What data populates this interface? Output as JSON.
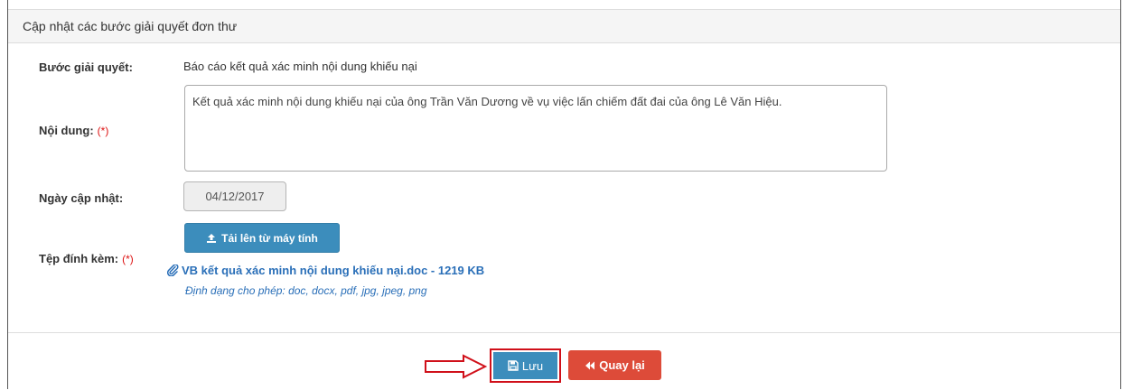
{
  "panel": {
    "title": "Cập nhật các bước giải quyết đơn thư"
  },
  "form": {
    "step_label": "Bước giải quyết:",
    "step_value": "Báo cáo kết quả xác minh nội dung khiếu nại",
    "content_label": "Nội dung:",
    "content_value": "Kết quả xác minh nội dung khiếu nại của ông Trần Văn Dương về vụ việc lấn chiếm đất đai của ông Lê Văn Hiệu.",
    "date_label": "Ngày cập nhật:",
    "date_value": "04/12/2017",
    "attach_label": "Tệp đính kèm:",
    "required_mark": "(*)",
    "upload_label": "Tải lên từ máy tính",
    "file_name": "VB kết quả xác minh nội dung khiếu nại.doc - 1219 KB",
    "formats_hint": "Định dạng cho phép: doc, docx, pdf, jpg, jpeg, png"
  },
  "actions": {
    "save_label": "Lưu",
    "back_label": "Quay lại"
  },
  "colors": {
    "primary": "#3c8dbc",
    "danger": "#dd4b39",
    "highlight": "#d0101a",
    "link": "#2a6fb8"
  },
  "icons": {
    "upload": "upload-icon",
    "attachment": "paperclip-icon",
    "save": "floppy-disk-icon",
    "back": "double-chevron-left-icon",
    "pointer": "arrow-right-icon"
  }
}
